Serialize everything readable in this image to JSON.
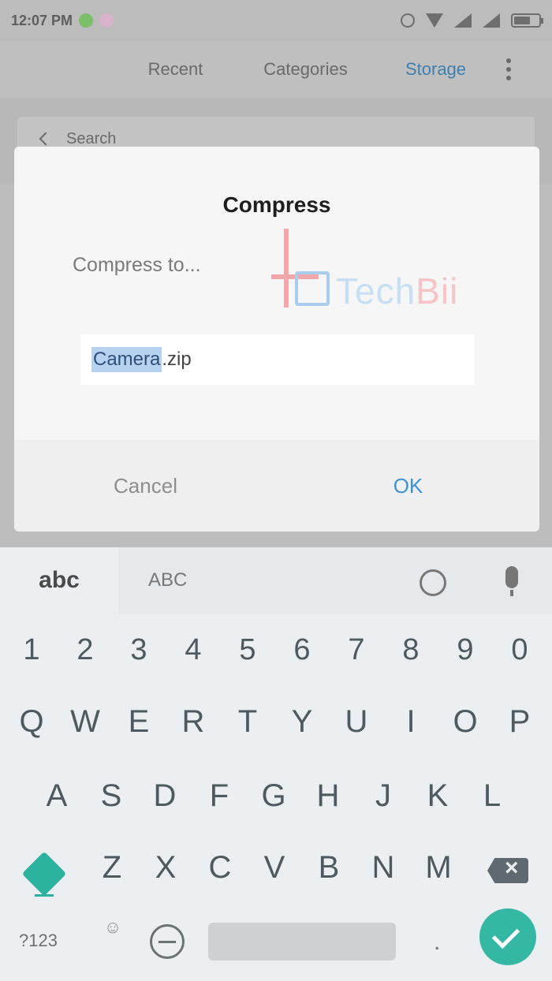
{
  "status_bar": {
    "time": "12:07 PM"
  },
  "app_bar": {
    "tabs": [
      {
        "label": "Recent"
      },
      {
        "label": "Categories"
      },
      {
        "label": "Storage"
      }
    ]
  },
  "search": {
    "placeholder": "Search"
  },
  "dialog": {
    "title": "Compress",
    "message": "Compress to...",
    "input_selected": "Camera",
    "input_rest": ".zip",
    "cancel_label": "Cancel",
    "ok_label": "OK"
  },
  "watermark": {
    "text_a": "Tech",
    "text_b": "Bii"
  },
  "keyboard": {
    "language": "abc",
    "alt_language": "ABC",
    "number_row": [
      "1",
      "2",
      "3",
      "4",
      "5",
      "6",
      "7",
      "8",
      "9",
      "0"
    ],
    "row1": [
      "Q",
      "W",
      "E",
      "R",
      "T",
      "Y",
      "U",
      "I",
      "O",
      "P"
    ],
    "row2": [
      "A",
      "S",
      "D",
      "F",
      "G",
      "H",
      "J",
      "K",
      "L"
    ],
    "row3": [
      "Z",
      "X",
      "C",
      "V",
      "B",
      "N",
      "M"
    ],
    "num_key": "?123",
    "period_key": ".",
    "settings_key": "☺",
    "accent_color": "#2bb3a0"
  }
}
